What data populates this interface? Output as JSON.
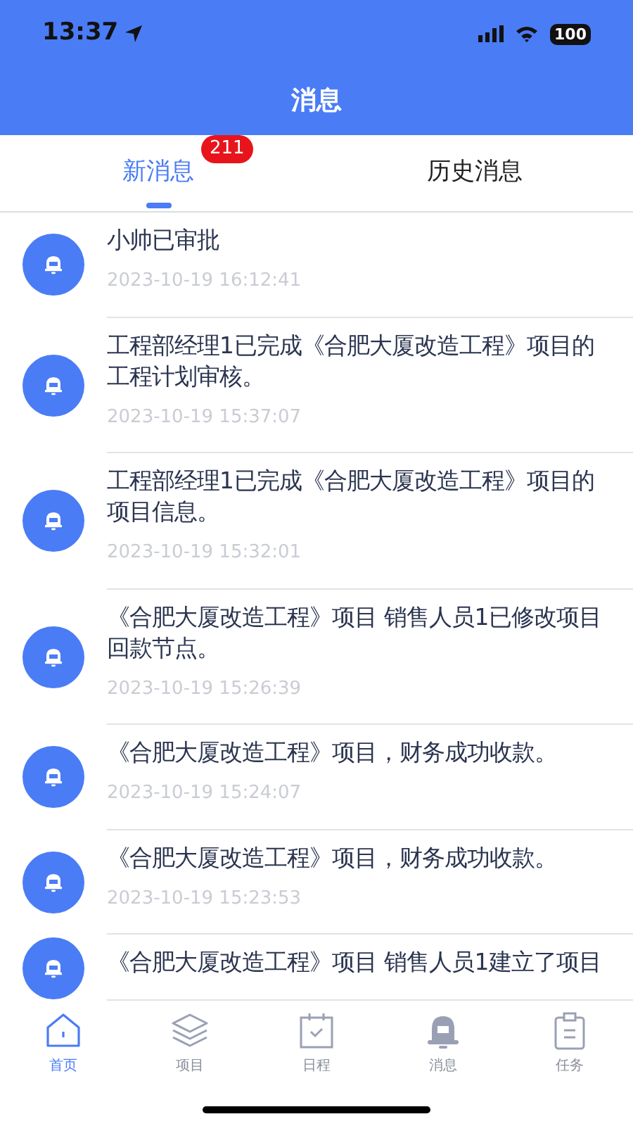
{
  "status_bar": {
    "time": "13:37",
    "battery": "100"
  },
  "header": {
    "title": "消息"
  },
  "tabs": [
    {
      "label": "新消息",
      "selected": true,
      "badge": "211"
    },
    {
      "label": "历史消息",
      "selected": false
    }
  ],
  "messages": [
    {
      "text": "小帅已审批",
      "time": "2023-10-19 16:12:41"
    },
    {
      "text": "工程部经理1已完成《合肥大厦改造工程》项目的工程计划审核。",
      "time": "2023-10-19 15:37:07"
    },
    {
      "text": "工程部经理1已完成《合肥大厦改造工程》项目的项目信息。",
      "time": "2023-10-19 15:32:01"
    },
    {
      "text": "《合肥大厦改造工程》项目 销售人员1已修改项目回款节点。",
      "time": "2023-10-19 15:26:39"
    },
    {
      "text": "《合肥大厦改造工程》项目，财务成功收款。",
      "time": "2023-10-19 15:24:07"
    },
    {
      "text": "《合肥大厦改造工程》项目，财务成功收款。",
      "time": "2023-10-19 15:23:53"
    },
    {
      "text": "《合肥大厦改造工程》项目 销售人员1建立了项目"
    }
  ],
  "bottom_nav": [
    {
      "kind": "home",
      "label": "首页",
      "selected": true
    },
    {
      "kind": "layers",
      "label": "项目",
      "selected": false
    },
    {
      "kind": "calendar",
      "label": "日程",
      "selected": false
    },
    {
      "kind": "bell",
      "label": "消息",
      "selected": false
    },
    {
      "kind": "clipboard",
      "label": "任务",
      "selected": false
    }
  ]
}
